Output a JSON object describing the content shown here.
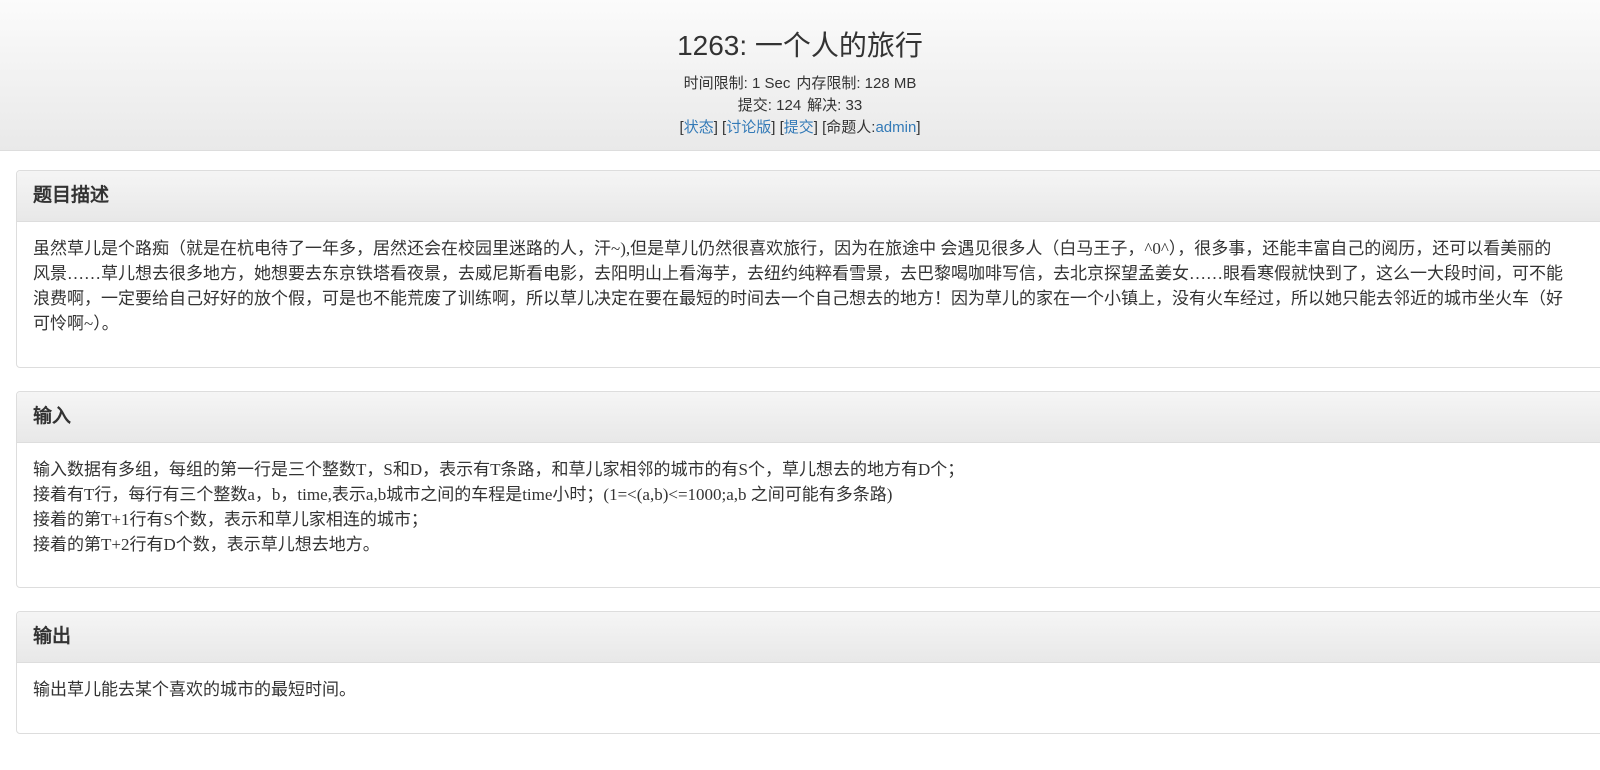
{
  "header": {
    "title": "1263: 一个人的旅行",
    "time_limit_label": "时间限制: 1 Sec",
    "memory_limit_label": "内存限制: 128 MB",
    "submit_label": "提交: 124",
    "solved_label": "解决: 33",
    "status_link": "状态",
    "discuss_link": "讨论版",
    "submit_link": "提交",
    "author_label": "命题人:",
    "author_link": "admin"
  },
  "sections": {
    "description": {
      "heading": "题目描述",
      "text": "虽然草儿是个路痴（就是在杭电待了一年多，居然还会在校园里迷路的人，汗~),但是草儿仍然很喜欢旅行，因为在旅途中 会遇见很多人（白马王子，^0^），很多事，还能丰富自己的阅历，还可以看美丽的风景……草儿想去很多地方，她想要去东京铁塔看夜景，去威尼斯看电影，去阳明山上看海芋，去纽约纯粹看雪景，去巴黎喝咖啡写信，去北京探望孟姜女……眼看寒假就快到了，这么一大段时间，可不能浪费啊，一定要给自己好好的放个假，可是也不能荒废了训练啊，所以草儿决定在要在最短的时间去一个自己想去的地方！因为草儿的家在一个小镇上，没有火车经过，所以她只能去邻近的城市坐火车（好可怜啊~）。"
    },
    "input": {
      "heading": "输入",
      "lines": [
        "输入数据有多组，每组的第一行是三个整数T，S和D，表示有T条路，和草儿家相邻的城市的有S个，草儿想去的地方有D个；",
        "接着有T行，每行有三个整数a，b，time,表示a,b城市之间的车程是time小时；(1=<(a,b)<=1000;a,b 之间可能有多条路)",
        "接着的第T+1行有S个数，表示和草儿家相连的城市；",
        "接着的第T+2行有D个数，表示草儿想去地方。"
      ]
    },
    "output": {
      "heading": "输出",
      "text": "输出草儿能去某个喜欢的城市的最短时间。"
    }
  }
}
